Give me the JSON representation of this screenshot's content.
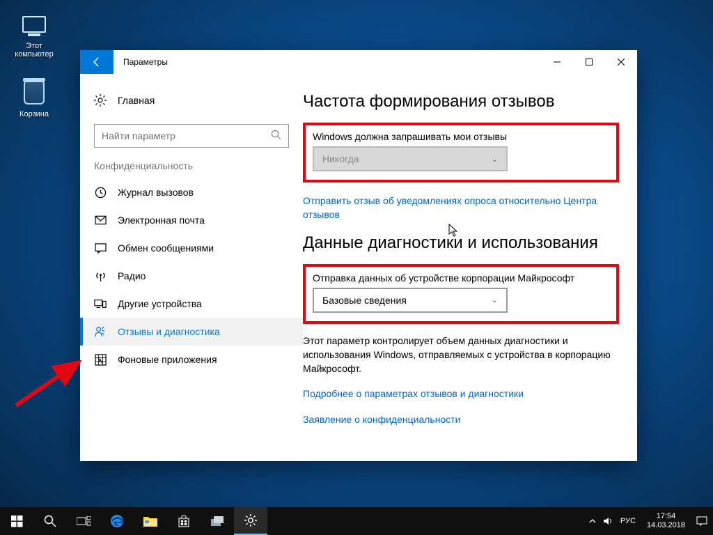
{
  "desktop": {
    "icons": {
      "this_pc": "Этот компьютер",
      "recycle_bin": "Корзина"
    }
  },
  "window": {
    "title": "Параметры",
    "sidebar": {
      "home": "Главная",
      "search_placeholder": "Найти параметр",
      "category": "Конфиденциальность",
      "items": [
        {
          "icon": "history",
          "label": "Журнал вызовов"
        },
        {
          "icon": "mail",
          "label": "Электронная почта"
        },
        {
          "icon": "chat",
          "label": "Обмен сообщениями"
        },
        {
          "icon": "radio",
          "label": "Радио"
        },
        {
          "icon": "devices",
          "label": "Другие устройства"
        },
        {
          "icon": "feedback",
          "label": "Отзывы и диагностика"
        },
        {
          "icon": "apps",
          "label": "Фоновые приложения"
        }
      ],
      "selected_index": 5
    },
    "content": {
      "section1_title": "Частота формирования отзывов",
      "feedback_label": "Windows должна запрашивать мои отзывы",
      "feedback_value": "Никогда",
      "feedback_link": "Отправить отзыв об уведомлениях опроса относительно Центра отзывов",
      "section2_title": "Данные диагностики и использования",
      "diag_label": "Отправка данных об устройстве корпорации Майкрософт",
      "diag_value": "Базовые сведения",
      "diag_desc": "Этот параметр контролирует объем данных диагностики и использования Windows, отправляемых с устройства в корпорацию Майкрософт.",
      "link_more": "Подробнее о параметрах отзывов и диагностики",
      "link_privacy": "Заявление о конфиденциальности"
    }
  },
  "taskbar": {
    "lang": "РУС",
    "time": "17:54",
    "date": "14.03.2018"
  }
}
